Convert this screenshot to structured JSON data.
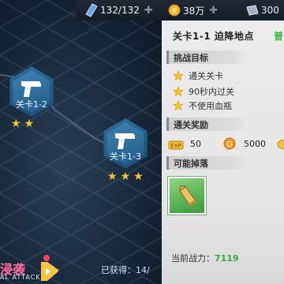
{
  "resources": {
    "stamina": "132/132",
    "gold": "38万",
    "gems": "300"
  },
  "stages": [
    {
      "label": "关卡1-2",
      "stars_earned": 2,
      "stars_total": 3
    },
    {
      "label": "关卡1-3",
      "stars_earned": 3,
      "stars_total": 3
    }
  ],
  "raid": {
    "title": "浸袭",
    "subtitle": "AL ATTACK"
  },
  "obtained_text": "已获得：14/",
  "panel": {
    "title": "关卡1-1 迫降地点",
    "difficulty": "普",
    "objectives_header": "挑战目标",
    "objectives": [
      "通关关卡",
      "90秒内过关",
      "不使用血瓶"
    ],
    "rewards_header": "通关奖励",
    "rewards": {
      "exp": "50",
      "gold": "5000"
    },
    "drops_header": "可能掉落",
    "power_label": "当前战力：",
    "power_value": "7119"
  },
  "colors": {
    "star_on": "#f6c431",
    "star_off": "#2a2f36",
    "difficulty": "#3ab34a",
    "power_value": "#3aa844",
    "raid": "#ff6a9c"
  }
}
